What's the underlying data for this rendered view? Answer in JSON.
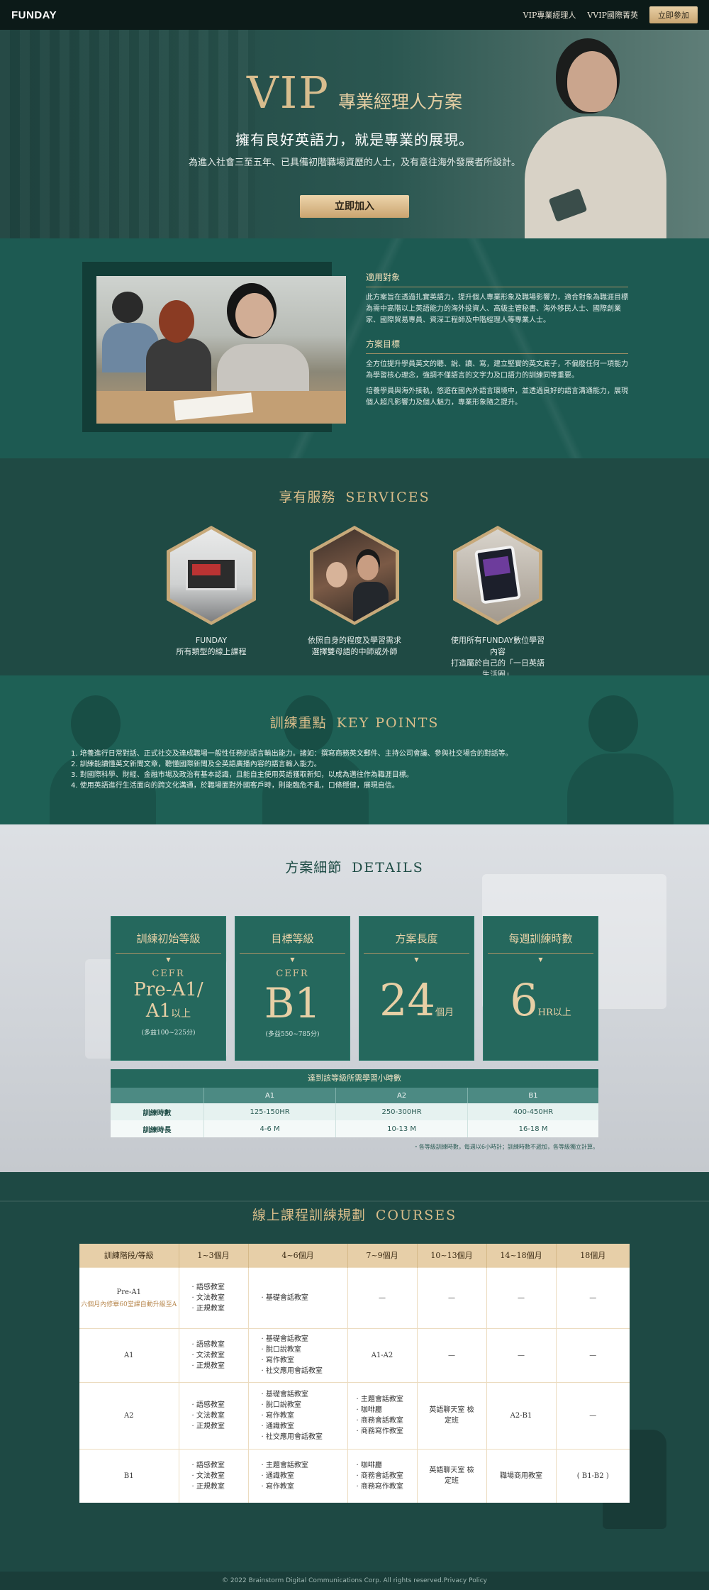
{
  "nav": {
    "logo": "FUNDAY",
    "links": [
      "VIP專業經理人",
      "VVIP國際菁英"
    ],
    "cta": "立即參加"
  },
  "hero": {
    "title_big": "VIP",
    "title_sub": "專業經理人方案",
    "tagline": "擁有良好英語力，就是專業的展現。",
    "desc": "為進入社會三至五年、已具備初階職場資歷的人士，及有意往海外發展者所設計。",
    "button": "立即加入"
  },
  "target": {
    "h1": "適用對象",
    "p1": "此方案旨在透過扎實英語力，提升個人專業形象及職場影響力，適合對象為職涯目標為需中高階以上英語能力的海外投資人、高級主管秘書、海外移民人士、國際創業家、國際貿易專員、資深工程師及中階經理人等專業人士。",
    "h2": "方案目標",
    "p2": "全方位提升學員英文的聽、說、讀、寫，建立堅實的英文底子，不偏廢任何一項能力為學習核心理念，強調不僅語言的文字力及口語力的訓練同等重要。",
    "p3": "培養學員與海外接軌，悠遊在國內外語言環境中，並透過良好的語言溝通能力，展現個人超凡影響力及個人魅力，專業形象隨之提升。"
  },
  "services": {
    "title_zh": "享有服務",
    "title_en": "SERVICES",
    "items": [
      {
        "line1": "FUNDAY",
        "line2": "所有類型的線上課程"
      },
      {
        "line1": "依照自身的程度及學習需求",
        "line2": "選擇雙母語的中師或外師"
      },
      {
        "line1": "使用所有FUNDAY數位學習內容",
        "line2": "打造屬於自己的「一日英語生活圈」"
      }
    ]
  },
  "keypoints": {
    "title_zh": "訓練重點",
    "title_en": "KEY POINTS",
    "items": [
      "1. 培養進行日常對話、正式社交及達成職場一般性任務的語言輸出能力。諸如：撰寫商務英文郵件、主持公司會議、參與社交場合的對話等。",
      "2. 訓練能讀懂英文新聞文章，聽懂國際新聞及全英語廣播內容的語言輸入能力。",
      "3. 對國際科學、財經、金融市場及政治有基本認識，且能自主使用英語獲取新知，以成為邁往作為職涯目標。",
      "4. 使用英語進行生活面向的跨文化溝通，於職場面對外國客戶時，則能臨危不亂，口條穩健，展現自信。"
    ]
  },
  "details": {
    "title_zh": "方案細節",
    "title_en": "DETAILS",
    "cards": [
      {
        "head": "訓練初始等級",
        "cefr": "CEFR",
        "level": "Pre-A1/",
        "level2": "A1",
        "suffix": "以上",
        "note": "(多益100~225分)"
      },
      {
        "head": "目標等級",
        "cefr": "CEFR",
        "level": "B1",
        "note": "(多益550~785分)"
      },
      {
        "head": "方案長度",
        "num": "24",
        "unit": "個月"
      },
      {
        "head": "每週訓練時數",
        "num": "6",
        "unit": "HR以上"
      }
    ],
    "hours_title": "達到該等級所需學習小時數",
    "hours_cols": [
      "A1",
      "A2",
      "B1"
    ],
    "hours_rows": [
      {
        "label": "訓練時數",
        "cells": [
          "125-150HR",
          "250-300HR",
          "400-450HR"
        ]
      },
      {
        "label": "訓練時長",
        "cells": [
          "4-6 M",
          "10-13 M",
          "16-18 M"
        ]
      }
    ],
    "note": "・各等級訓練時數，每週以6小時計；訓練時數不遞加，各等級獨立計算。"
  },
  "courses": {
    "title_zh": "線上課程訓練規劃",
    "title_en": "COURSES",
    "headers": [
      "訓練階段/等級",
      "1~3個月",
      "4~6個月",
      "7~9個月",
      "10~13個月",
      "14~18個月",
      "18個月"
    ],
    "rows": [
      {
        "level": "Pre-A1",
        "level_sub": "六個月內修畢60堂課自動升級至A",
        "c1": [
          "語感教室",
          "文法教室",
          "正規教室"
        ],
        "c2": [
          "基礎會話教室"
        ],
        "c3": "—",
        "c4": "—",
        "c5": "—",
        "c6": "—"
      },
      {
        "level": "A1",
        "c1": [
          "語感教室",
          "文法教室",
          "正規教室"
        ],
        "c2": [
          "基礎會話教室",
          "脫口說教室",
          "寫作教室",
          "社交應用會話教室"
        ],
        "c3": "A1-A2",
        "c4": "—",
        "c5": "—",
        "c6": "—"
      },
      {
        "level": "A2",
        "c1": [
          "語感教室",
          "文法教室",
          "正規教室"
        ],
        "c2": [
          "基礎會話教室",
          "脫口說教室",
          "寫作教室",
          "通識教室",
          "社交應用會話教室"
        ],
        "c3": [
          "主題會話教室",
          "咖啡廳",
          "商務會話教室",
          "商務寫作教室"
        ],
        "c4": "英語聊天室 檢定班",
        "c5": "A2-B1",
        "c6": "—"
      },
      {
        "level": "B1",
        "c1": [
          "語感教室",
          "文法教室",
          "正規教室"
        ],
        "c2": [
          "主題會話教室",
          "通識教室",
          "寫作教室"
        ],
        "c3": [
          "咖啡廳",
          "商務會話教室",
          "商務寫作教室"
        ],
        "c4": "英語聊天室 檢定班",
        "c5": "職場商用教室",
        "c6": "( B1-B2 )"
      }
    ]
  },
  "footer": "© 2022 Brainstorm Digital Communications Corp. All rights reserved.Privacy Policy",
  "colors": {
    "gold": "#d8bd8e",
    "teal": "#25685d",
    "dark": "#1e4944"
  }
}
